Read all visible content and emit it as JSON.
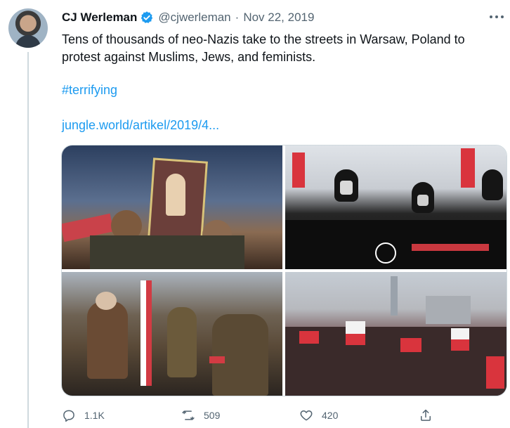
{
  "tweet": {
    "display_name": "CJ Werleman",
    "handle": "@cjwerleman",
    "separator": "·",
    "date": "Nov 22, 2019",
    "text": "Tens of thousands of neo-Nazis take to the streets in Warsaw, Poland to protest against Muslims, Jews, and feminists.",
    "hashtag": "#terrifying",
    "link": "jungle.world/artikel/2019/4..."
  },
  "actions": {
    "replies": "1.1K",
    "retweets": "509",
    "likes": "420"
  },
  "icons": {
    "verified": "verified-badge-icon",
    "more": "more-options-icon",
    "reply": "reply-icon",
    "retweet": "retweet-icon",
    "like": "heart-icon",
    "share": "share-icon"
  },
  "colors": {
    "link": "#1d9bf0",
    "secondary_text": "#536471",
    "primary_text": "#0f1419",
    "verified": "#1d9bf0"
  },
  "media": {
    "count": 4
  }
}
